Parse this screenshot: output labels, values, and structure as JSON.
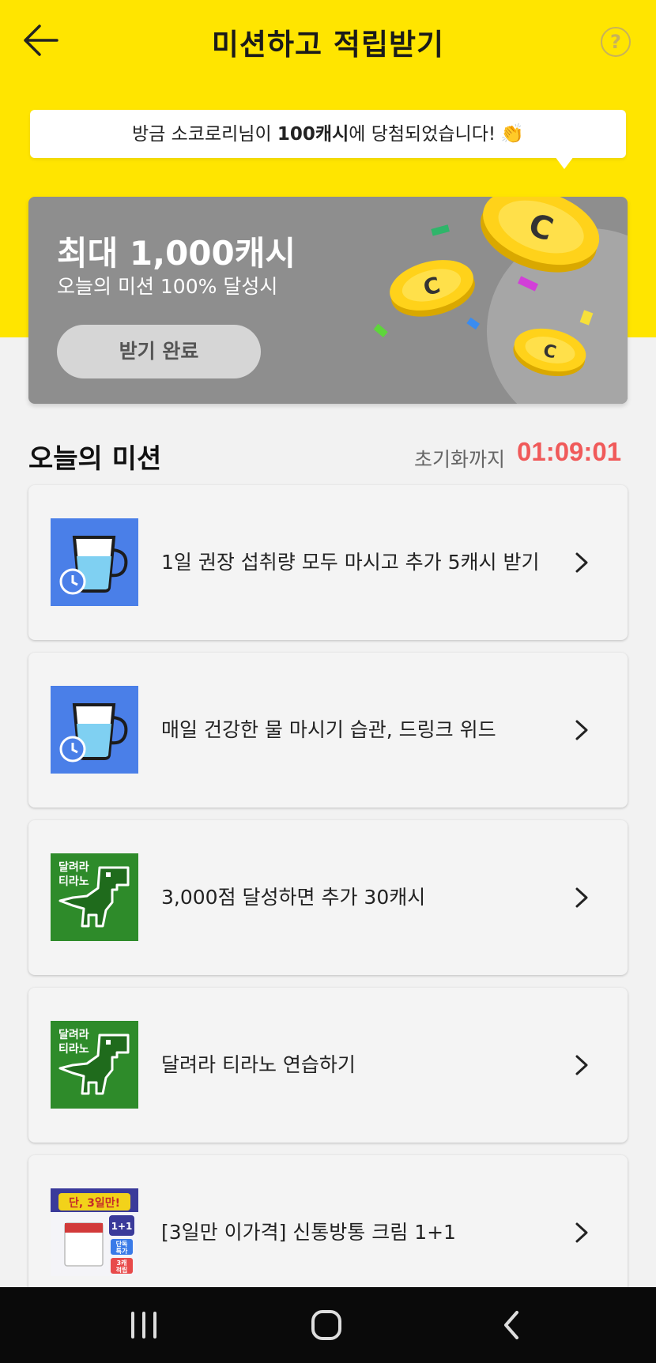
{
  "header": {
    "title": "미션하고 적립받기",
    "help_symbol": "?"
  },
  "winner": {
    "prefix": "방금 소코로리님이 ",
    "amount": "100캐시",
    "suffix": "에 당첨되었습니다!"
  },
  "banner": {
    "title": "최대 1,000캐시",
    "subtitle": "오늘의 미션 100% 달성시",
    "button_label": "받기 완료",
    "coin_letter": "C"
  },
  "section": {
    "title": "오늘의 미션",
    "reset_label": "초기화까지",
    "reset_time": "01:09:01"
  },
  "missions": [
    {
      "label": "1일 권장 섭취량 모두 마시고 추가 5캐시 받기",
      "icon": "water-cup-alarm-icon"
    },
    {
      "label": "매일 건강한 물 마시기 습관, 드링크 위드",
      "icon": "water-cup-alarm-icon"
    },
    {
      "label": "3,000점 달성하면 추가 30캐시",
      "icon": "dino-run-game-icon",
      "thumb_text": [
        "달려라",
        "티라노"
      ]
    },
    {
      "label": "달려라 티라노 연습하기",
      "icon": "dino-run-game-icon",
      "thumb_text": [
        "달려라",
        "티라노"
      ]
    },
    {
      "label": "[3일만 이가격] 신통방통 크림 1+1",
      "icon": "cream-promo-thumbnail",
      "thumb_text": [
        "단, 3일만!",
        "1+1",
        "단독",
        "특가",
        "3캐",
        "적립"
      ]
    }
  ],
  "colors": {
    "brand_yellow": "#ffe500",
    "timer_red": "#f05a5a",
    "cup_blue": "#4a7fe8",
    "dino_green": "#2e8b2a"
  }
}
